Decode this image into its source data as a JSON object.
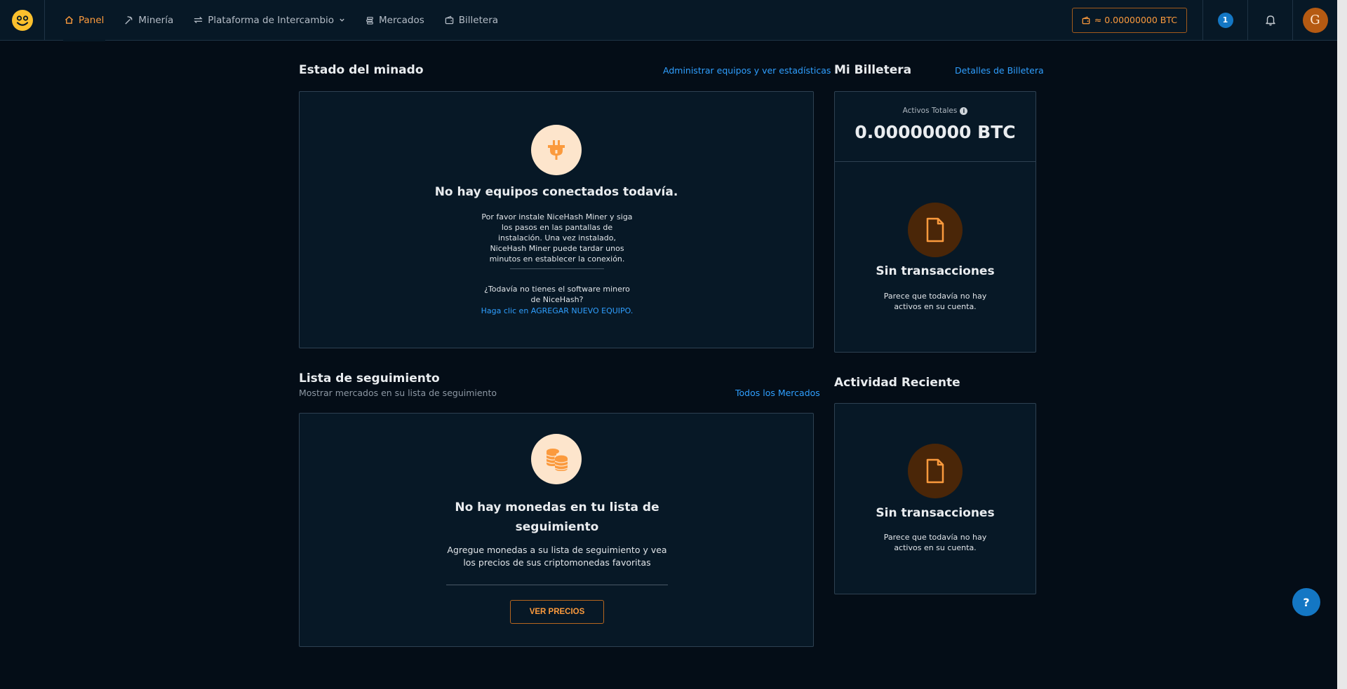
{
  "nav": {
    "items": [
      {
        "label": "Panel",
        "icon": "home-icon",
        "active": true
      },
      {
        "label": "Minería",
        "icon": "pickaxe-icon"
      },
      {
        "label": "Plataforma de Intercambio",
        "icon": "exchange-icon"
      },
      {
        "label": "Mercados",
        "icon": "coins-icon"
      },
      {
        "label": "Billetera",
        "icon": "wallet-icon"
      }
    ],
    "wallet_balance": "≈ 0.00000000 BTC",
    "notification_count": "1",
    "avatar_letter": "G"
  },
  "mining": {
    "title": "Estado del minado",
    "link": "Administrar equipos y ver estadísticas",
    "empty_title": "No hay equipos conectados todavía.",
    "empty_text": "Por favor instale NiceHash Miner y siga los pasos en las pantallas de instalación. Una vez instalado, NiceHash Miner puede tardar unos minutos en establecer la conexión.",
    "no_software_text": "¿Todavía no tienes el software minero de NiceHash?",
    "add_rig_link": "Haga clic en AGREGAR NUEVO EQUIPO."
  },
  "watchlist": {
    "title": "Lista de seguimiento",
    "subtitle": "Mostrar mercados en su lista de seguimiento",
    "link": "Todos los Mercados",
    "empty_title": "No hay monedas en tu lista de seguimiento",
    "empty_text": "Agregue monedas a su lista de seguimiento y vea los precios de sus criptomonedas favoritas",
    "button": "VER PRECIOS"
  },
  "wallet": {
    "title": "Mi Billetera",
    "link": "Detalles de Billetera",
    "total_label": "Activos Totales",
    "total_value": "0.00000000 BTC",
    "empty_title": "Sin transacciones",
    "empty_text": "Parece que todavía no hay activos en su cuenta."
  },
  "activity": {
    "title": "Actividad Reciente",
    "empty_title": "Sin transacciones",
    "empty_text": "Parece que todavía no hay activos en su cuenta."
  },
  "help_label": "?",
  "colors": {
    "accent": "#fb9a3d",
    "link": "#2f9fff",
    "background": "#040d17",
    "card": "#071826",
    "badge": "#1477c4"
  }
}
